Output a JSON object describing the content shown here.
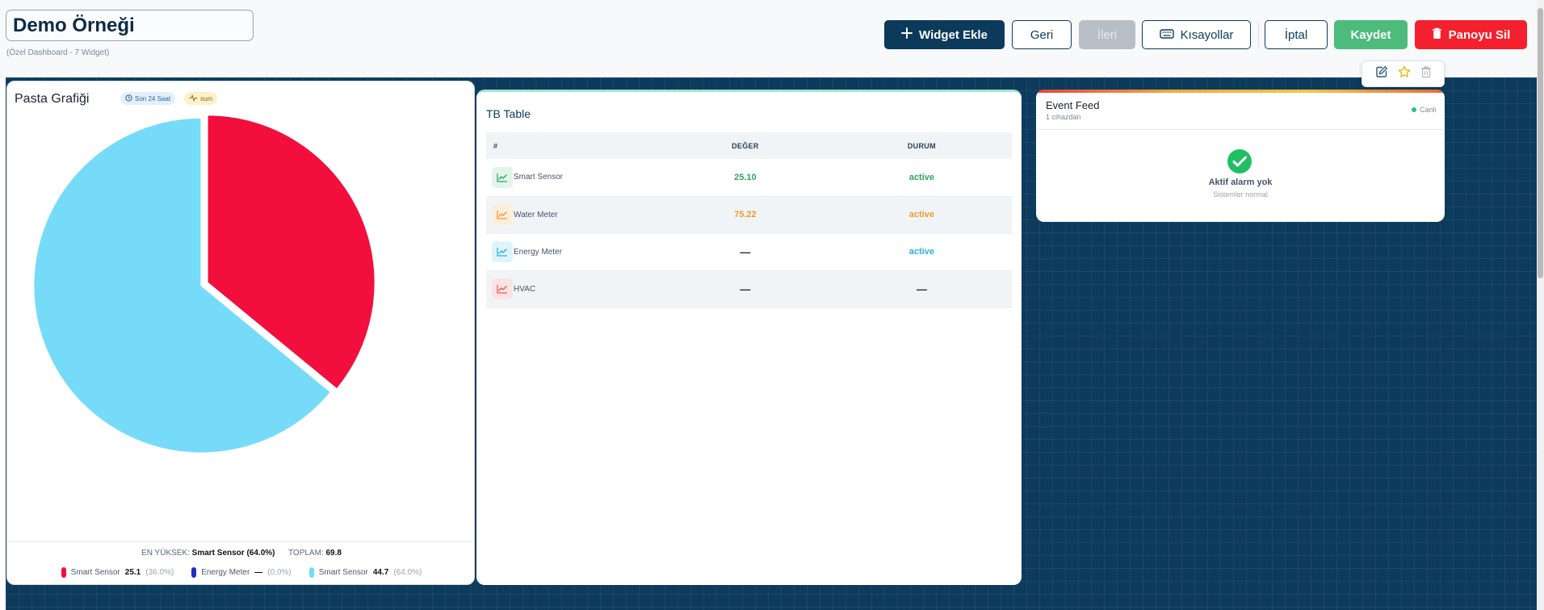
{
  "header": {
    "title": "Demo Örneği",
    "subtitle": "(Özel Dashboard - 7 Widget)",
    "buttons": {
      "add_widget": "Widget Ekle",
      "back": "Geri",
      "forward": "İleri",
      "shortcuts": "Kısayollar",
      "cancel": "İptal",
      "save": "Kaydet",
      "delete_panel": "Panoyu Sil"
    }
  },
  "pie_widget": {
    "title": "Pasta Grafiği",
    "chip_time": "Son 24 Saat",
    "chip_agg": "sum",
    "highest_label": "EN YÜKSEK:",
    "highest_value": "Smart Sensor (64.0%)",
    "total_label": "TOPLAM:",
    "total_value": "69.8",
    "legend": [
      {
        "name": "Smart Sensor",
        "value": "25.1",
        "pct": "(36.0%)",
        "color": "#f20f3d"
      },
      {
        "name": "Energy Meter",
        "value": "—",
        "pct": "(0.0%)",
        "color": "#1d2fbf"
      },
      {
        "name": "Smart Sensor",
        "value": "44.7",
        "pct": "(64.0%)",
        "color": "#76dbf8"
      }
    ]
  },
  "chart_data": {
    "type": "pie",
    "title": "Pasta Grafiği",
    "categories": [
      "Smart Sensor",
      "Energy Meter",
      "Smart Sensor"
    ],
    "values": [
      25.1,
      0,
      44.7
    ],
    "percentages": [
      36.0,
      0.0,
      64.0
    ],
    "colors": [
      "#f20f3d",
      "#1d2fbf",
      "#76dbf8"
    ],
    "legend": "bottom"
  },
  "table_widget": {
    "title": "TB Table",
    "columns": [
      "#",
      "DEĞER",
      "DURUM"
    ],
    "rows": [
      {
        "name": "Smart Sensor",
        "value": "25.10",
        "status": "active",
        "color": "#2fa65b",
        "icon_bg": "#e3f5ea"
      },
      {
        "name": "Water Meter",
        "value": "75.22",
        "status": "active",
        "color": "#f39a2b",
        "icon_bg": "#fdeedb"
      },
      {
        "name": "Energy Meter",
        "value": "—",
        "status": "active",
        "color": "#27b3d8",
        "icon_bg": "#def4fb"
      },
      {
        "name": "HVAC",
        "value": "—",
        "status": "—",
        "color": "#e85a5a",
        "icon_bg": "#fbe3e3"
      }
    ]
  },
  "feed_widget": {
    "title": "Event Feed",
    "subtitle": "1 cihazdan",
    "live": "Canlı",
    "empty_title": "Aktif alarm yok",
    "empty_sub": "Sistemler normal"
  },
  "icons": [
    "plus-icon",
    "keyboard-icon",
    "trash-icon",
    "clock-icon",
    "pulse-icon",
    "trend-icon",
    "check-circle-icon",
    "edit-icon",
    "star-icon"
  ]
}
